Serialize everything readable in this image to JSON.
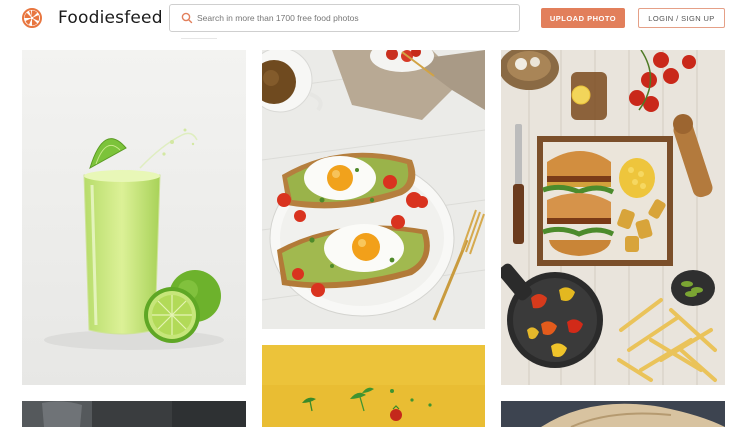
{
  "header": {
    "brand": "Foodiesfeed",
    "search_placeholder": "Search in more than 1700 free food photos",
    "upload_label": "UPLOAD PHOTO",
    "login_label": "LOGIN / SIGN UP"
  },
  "colors": {
    "accent": "#e27f5b",
    "logo": "#e8763f",
    "border": "#cfcfcf"
  },
  "icons": {
    "logo": "orange-slice-icon",
    "search": "search-icon"
  },
  "photos": [
    {
      "subject": "lime-drink-photo"
    },
    {
      "subject": "avocado-toast-eggs-photo"
    },
    {
      "subject": "burgers-fries-spread-photo"
    },
    {
      "subject": "yellow-flying-veggies-photo"
    },
    {
      "subject": "glass-dark-photo"
    },
    {
      "subject": "wrap-dark-photo"
    }
  ]
}
